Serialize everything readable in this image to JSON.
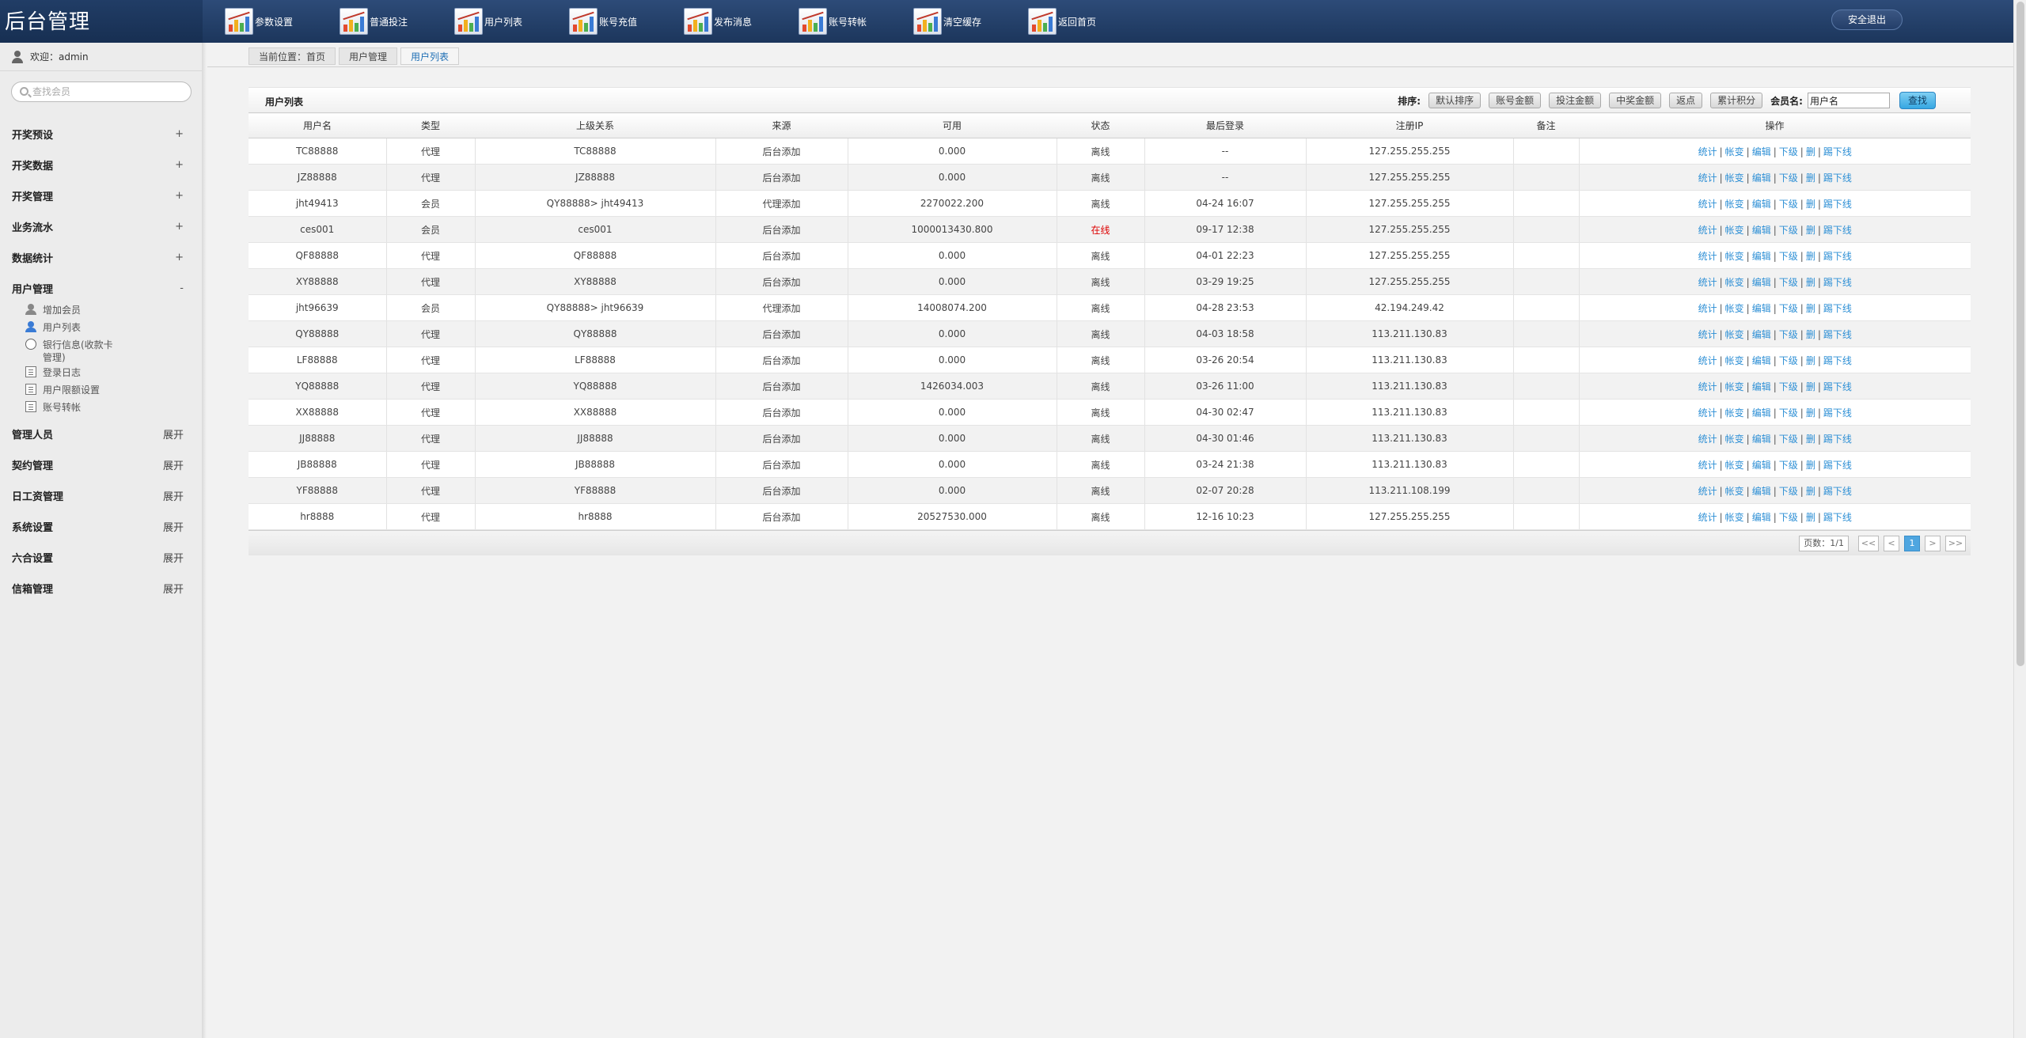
{
  "app": {
    "title": "后台管理",
    "logout_label": "安全退出"
  },
  "topnav": [
    {
      "label": "参数设置"
    },
    {
      "label": "普通投注"
    },
    {
      "label": "用户列表"
    },
    {
      "label": "账号充值"
    },
    {
      "label": "发布消息"
    },
    {
      "label": "账号转帐"
    },
    {
      "label": "清空缓存"
    },
    {
      "label": "返回首页"
    }
  ],
  "sidebar": {
    "welcome": "欢迎：admin",
    "search_placeholder": "查找会员",
    "groups": [
      {
        "label": "开奖预设",
        "toggle": "+"
      },
      {
        "label": "开奖数据",
        "toggle": "+"
      },
      {
        "label": "开奖管理",
        "toggle": "+"
      },
      {
        "label": "业务流水",
        "toggle": "+"
      },
      {
        "label": "数据统计",
        "toggle": "+"
      },
      {
        "label": "用户管理",
        "toggle": "-"
      },
      {
        "label": "管理人员",
        "toggle": "展开"
      },
      {
        "label": "契约管理",
        "toggle": "展开"
      },
      {
        "label": "日工资管理",
        "toggle": "展开"
      },
      {
        "label": "系统设置",
        "toggle": "展开"
      },
      {
        "label": "六合设置",
        "toggle": "展开"
      },
      {
        "label": "信箱管理",
        "toggle": "展开"
      }
    ],
    "user_mgmt_items": [
      {
        "label": "增加会员",
        "icon": "user-add-icon"
      },
      {
        "label": "用户列表",
        "icon": "user-icon"
      },
      {
        "label": "银行信息(收款卡管理)",
        "icon": "radio-icon"
      },
      {
        "label": "登录日志",
        "icon": "document-icon"
      },
      {
        "label": "用户限额设置",
        "icon": "document-icon"
      },
      {
        "label": "账号转帐",
        "icon": "document-icon"
      }
    ]
  },
  "breadcrumb": [
    "当前位置：首页",
    "用户管理",
    "用户列表"
  ],
  "panel": {
    "title": "用户列表",
    "sort_label": "排序:",
    "sort_buttons": [
      "默认排序",
      "账号金额",
      "投注金额",
      "中奖金额",
      "返点",
      "累计积分"
    ],
    "member_label": "会员名:",
    "member_value": "用户名",
    "find_label": "查找"
  },
  "table": {
    "columns": [
      "用户名",
      "类型",
      "上级关系",
      "来源",
      "可用",
      "状态",
      "最后登录",
      "注册IP",
      "备注",
      "操作"
    ],
    "rows": [
      [
        "TC88888",
        "代理",
        "TC88888",
        "后台添加",
        "0.000",
        "离线",
        "--",
        "127.255.255.255",
        ""
      ],
      [
        "JZ88888",
        "代理",
        "JZ88888",
        "后台添加",
        "0.000",
        "离线",
        "--",
        "127.255.255.255",
        ""
      ],
      [
        "jht49413",
        "会员",
        "QY88888> jht49413",
        "代理添加",
        "2270022.200",
        "离线",
        "04-24 16:07",
        "127.255.255.255",
        ""
      ],
      [
        "ces001",
        "会员",
        "ces001",
        "后台添加",
        "1000013430.800",
        "在线",
        "09-17 12:38",
        "127.255.255.255",
        ""
      ],
      [
        "QF88888",
        "代理",
        "QF88888",
        "后台添加",
        "0.000",
        "离线",
        "04-01 22:23",
        "127.255.255.255",
        ""
      ],
      [
        "XY88888",
        "代理",
        "XY88888",
        "后台添加",
        "0.000",
        "离线",
        "03-29 19:25",
        "127.255.255.255",
        ""
      ],
      [
        "jht96639",
        "会员",
        "QY88888> jht96639",
        "代理添加",
        "14008074.200",
        "离线",
        "04-28 23:53",
        "42.194.249.42",
        ""
      ],
      [
        "QY88888",
        "代理",
        "QY88888",
        "后台添加",
        "0.000",
        "离线",
        "04-03 18:58",
        "113.211.130.83",
        ""
      ],
      [
        "LF88888",
        "代理",
        "LF88888",
        "后台添加",
        "0.000",
        "离线",
        "03-26 20:54",
        "113.211.130.83",
        ""
      ],
      [
        "YQ88888",
        "代理",
        "YQ88888",
        "后台添加",
        "1426034.003",
        "离线",
        "03-26 11:00",
        "113.211.130.83",
        ""
      ],
      [
        "XX88888",
        "代理",
        "XX88888",
        "后台添加",
        "0.000",
        "离线",
        "04-30 02:47",
        "113.211.130.83",
        ""
      ],
      [
        "JJ88888",
        "代理",
        "JJ88888",
        "后台添加",
        "0.000",
        "离线",
        "04-30 01:46",
        "113.211.130.83",
        ""
      ],
      [
        "JB88888",
        "代理",
        "JB88888",
        "后台添加",
        "0.000",
        "离线",
        "03-24 21:38",
        "113.211.130.83",
        ""
      ],
      [
        "YF88888",
        "代理",
        "YF88888",
        "后台添加",
        "0.000",
        "离线",
        "02-07 20:28",
        "113.211.108.199",
        ""
      ],
      [
        "hr8888",
        "代理",
        "hr8888",
        "后台添加",
        "20527530.000",
        "离线",
        "12-16 10:23",
        "127.255.255.255",
        ""
      ]
    ],
    "actions": [
      "统计",
      "帐变",
      "编辑",
      "下级",
      "删",
      "踢下线"
    ]
  },
  "pager": {
    "info": "页数：1/1",
    "first": "<<",
    "prev": "<",
    "current": "1",
    "next": ">",
    "last": ">>"
  },
  "colors": {
    "header_bg": "#1f3a63",
    "online": "#dd0000",
    "link": "#2d8fd5",
    "find_button": "#36a7e2"
  }
}
